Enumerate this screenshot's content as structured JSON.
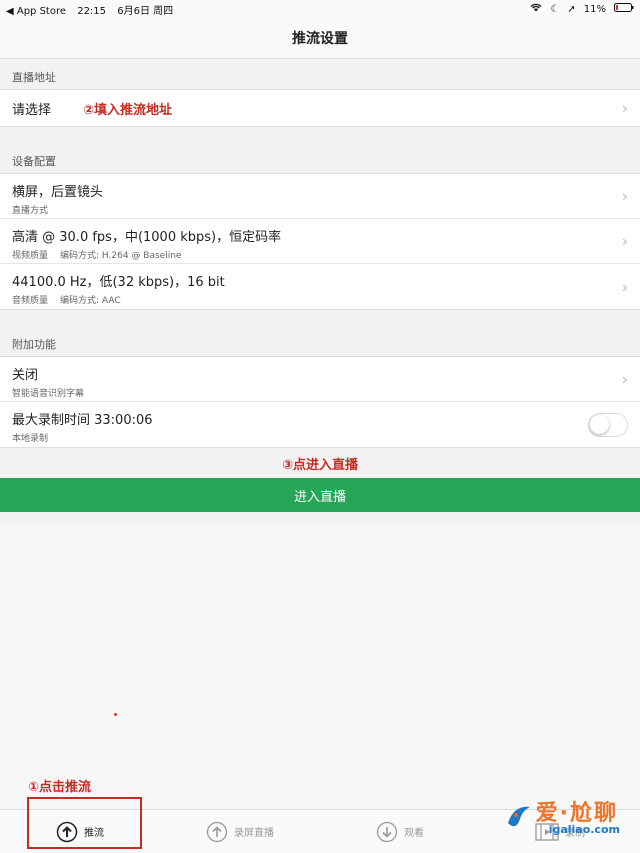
{
  "status_bar": {
    "back_app": "◀ App Store",
    "time": "22:15",
    "date": "6月6日 周四",
    "battery": "11%"
  },
  "nav": {
    "title": "推流设置"
  },
  "sections": {
    "live_address": {
      "header": "直播地址",
      "select_label": "请选择",
      "annotation": "②填入推流地址"
    },
    "device": {
      "header": "设备配置",
      "orientation": {
        "title": "横屏，后置镜头",
        "sub": "直播方式"
      },
      "video": {
        "title": "高清 @ 30.0 fps，中(1000 kbps)，恒定码率",
        "sub1": "视频质量",
        "sub2": "编码方式: H.264 @ Baseline"
      },
      "audio": {
        "title": "44100.0 Hz，低(32 kbps)，16 bit",
        "sub1": "音频质量",
        "sub2": "编码方式: AAC"
      }
    },
    "extra": {
      "header": "附加功能",
      "subtitle": {
        "title": "关闭",
        "sub": "智能语音识别字幕"
      },
      "record": {
        "title": "最大录制时间  33:00:06",
        "sub": "本地录制",
        "toggle_on": false
      }
    }
  },
  "enter_annotation": "③点进入直播",
  "enter_button": "进入直播",
  "bottom_annotation": "①点击推流",
  "tabs": [
    {
      "label": "推流",
      "icon": "upload-circle-icon",
      "active": true
    },
    {
      "label": "录屏直播",
      "icon": "upload-circle-icon",
      "active": false
    },
    {
      "label": "观看",
      "icon": "download-circle-icon",
      "active": false
    },
    {
      "label": "录制",
      "icon": "film-icon",
      "active": false
    }
  ],
  "watermark": {
    "text": "爱·尬聊",
    "url": "igaliao.com"
  },
  "colors": {
    "accent_green": "#27a557",
    "annotation_red": "#c72b23"
  }
}
